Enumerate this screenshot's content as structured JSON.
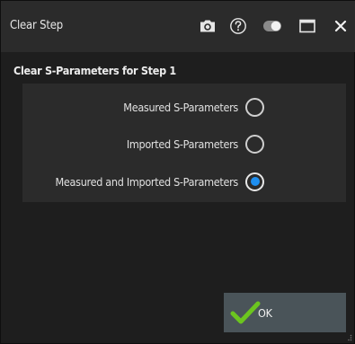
{
  "window": {
    "title": "Clear Step",
    "icons": [
      "camera-icon",
      "help-icon",
      "toggle-icon",
      "maximize-icon",
      "close-icon"
    ]
  },
  "section": {
    "title": "Clear S-Parameters for Step 1"
  },
  "options": [
    {
      "label": "Measured S-Parameters",
      "checked": false
    },
    {
      "label": "Imported S-Parameters",
      "checked": false
    },
    {
      "label": "Measured and Imported S-Parameters",
      "checked": true
    }
  ],
  "ok_button": {
    "label": "OK",
    "icon": "checkmark-icon"
  },
  "colors": {
    "accent": "#1e8ff0",
    "check": "#6cc51f",
    "background": "#1e1e1e",
    "panel": "#2b2b2b",
    "button": "#4a5459"
  }
}
